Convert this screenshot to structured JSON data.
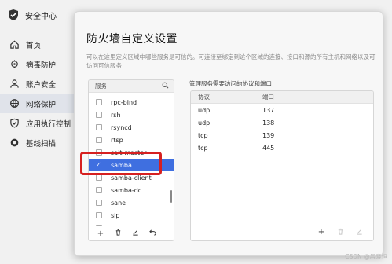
{
  "app": {
    "title": "安全中心"
  },
  "sidebar": {
    "items": [
      {
        "label": "首页",
        "icon": "home-icon"
      },
      {
        "label": "病毒防护",
        "icon": "virus-icon"
      },
      {
        "label": "账户安全",
        "icon": "user-icon"
      },
      {
        "label": "网络保护",
        "icon": "network-icon"
      },
      {
        "label": "应用执行控制",
        "icon": "shield-check-icon"
      },
      {
        "label": "基线扫描",
        "icon": "scan-icon"
      }
    ]
  },
  "dialog": {
    "title": "防火墙自定义设置",
    "description": "可以在这里定义区域中哪些服务是可信的。可连接至绑定到这个区域的连接、接口和源的所有主机和网络以及可访问可信服务",
    "services_header": "服务",
    "services": [
      {
        "name": "rpc-bind",
        "checked": false
      },
      {
        "name": "rsh",
        "checked": false
      },
      {
        "name": "rsyncd",
        "checked": false
      },
      {
        "name": "rtsp",
        "checked": false
      },
      {
        "name": "salt-master",
        "checked": false
      },
      {
        "name": "samba",
        "checked": true
      },
      {
        "name": "samba-client",
        "checked": false
      },
      {
        "name": "samba-dc",
        "checked": false
      },
      {
        "name": "sane",
        "checked": false
      },
      {
        "name": "sip",
        "checked": false
      },
      {
        "name": "sips",
        "checked": false
      }
    ],
    "right_caption": "管理服务需要访问的协议和端口",
    "table_headers": {
      "protocol": "协议",
      "port": "端口"
    },
    "ports": [
      {
        "protocol": "udp",
        "port": "137"
      },
      {
        "protocol": "udp",
        "port": "138"
      },
      {
        "protocol": "tcp",
        "port": "139"
      },
      {
        "protocol": "tcp",
        "port": "445"
      }
    ],
    "colors": {
      "selected": "#3f6fe0",
      "highlight": "#d62020"
    }
  },
  "watermark": "CSDN @吕晓恒"
}
